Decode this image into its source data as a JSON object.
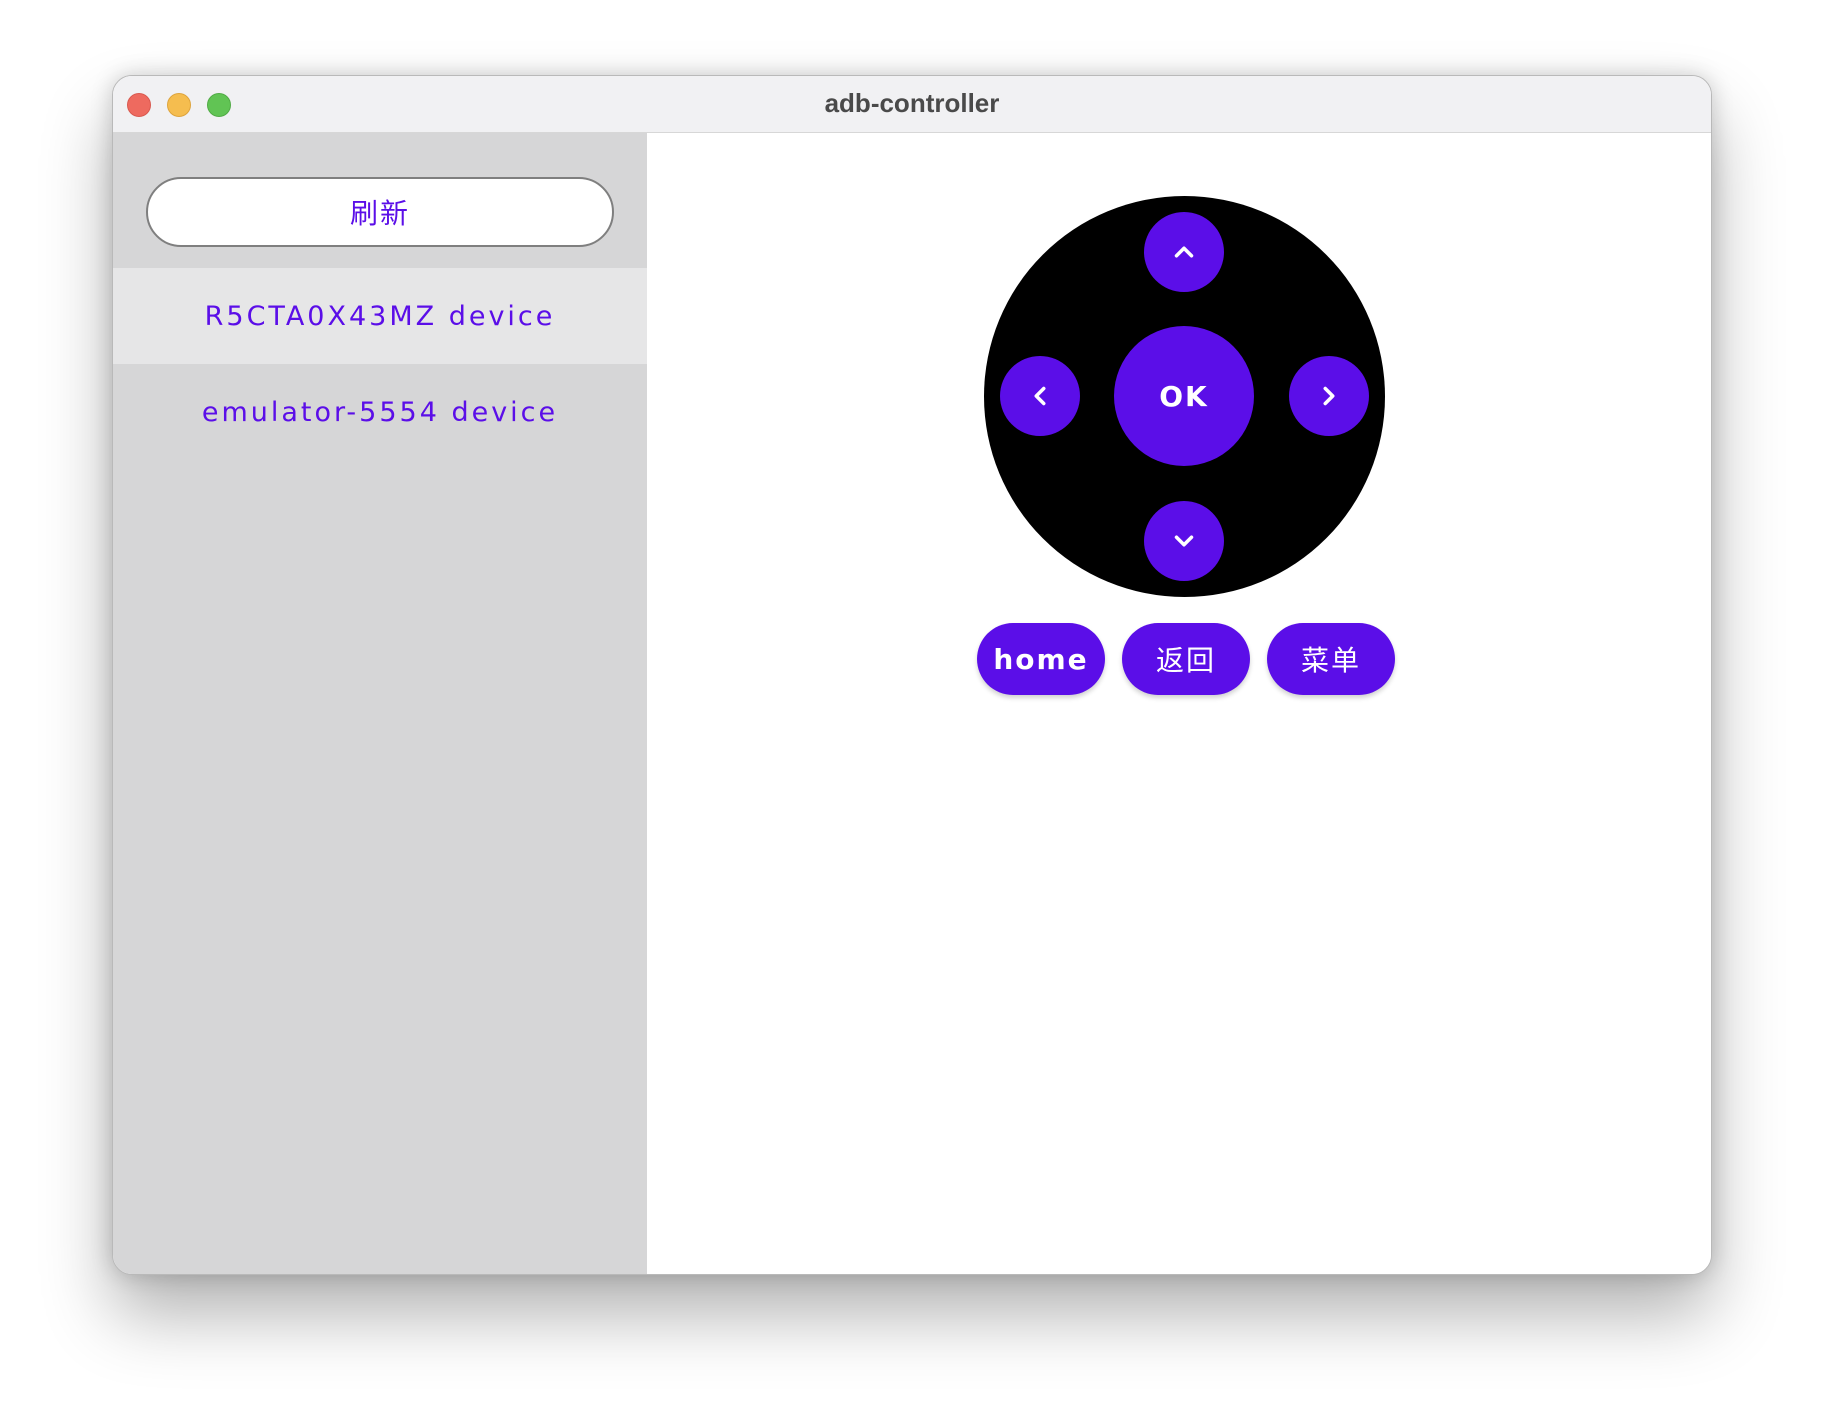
{
  "window": {
    "title": "adb-controller"
  },
  "sidebar": {
    "refresh_label": "刷新",
    "devices": [
      {
        "label": "R5CTA0X43MZ device",
        "selected": true
      },
      {
        "label": "emulator-5554 device",
        "selected": false
      }
    ]
  },
  "remote": {
    "ok_label": "OK",
    "up_icon": "chevron-up-icon",
    "down_icon": "chevron-down-icon",
    "left_icon": "chevron-left-icon",
    "right_icon": "chevron-right-icon",
    "home_label": "home",
    "back_label": "返回",
    "menu_label": "菜单"
  },
  "colors": {
    "accent": "#5b0ee8",
    "sidebar_bg": "#d6d6d7",
    "selected_item_bg": "#e6e6e7",
    "dpad_bg": "#000000"
  }
}
